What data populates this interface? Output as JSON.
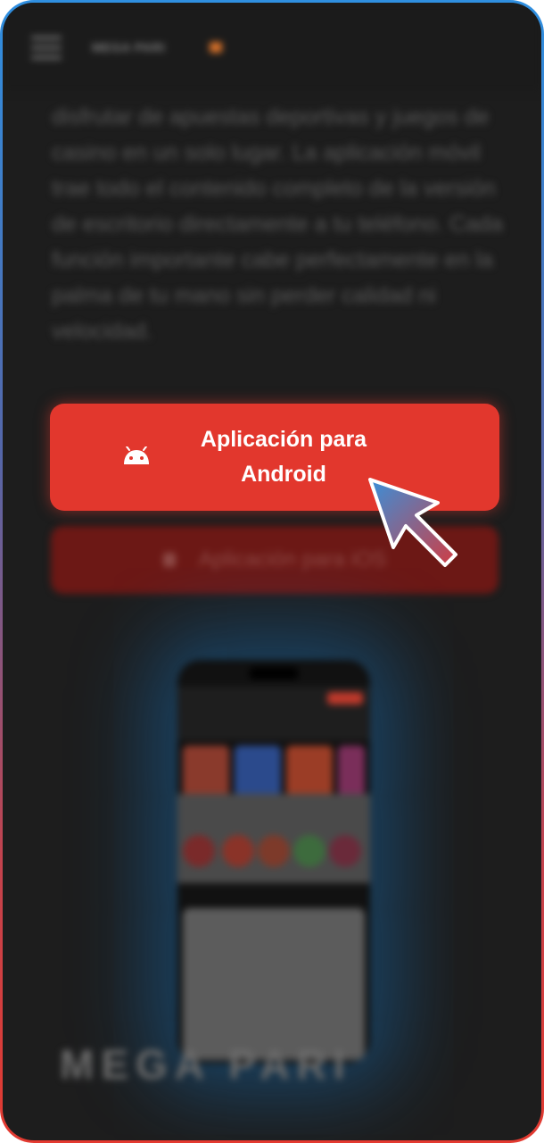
{
  "header": {
    "logo_text": "MEGA PARI",
    "menu_icon": "hamburger-menu-icon"
  },
  "content": {
    "paragraph": "disfrutar de apuestas deportivas y juegos de casino en un solo lugar. La aplicación móvil trae todo el contenido completo de la versión de escritorio directamente a tu teléfono. Cada función importante cabe perfectamente en la palma de tu mano sin perder calidad ni velocidad."
  },
  "buttons": {
    "android": {
      "label": "Aplicación para Android",
      "icon": "android-icon"
    },
    "ios": {
      "label": "Aplicación para iOS",
      "icon": "apple-icon"
    }
  },
  "promo": {
    "watermark": "MEGA PARI"
  },
  "colors": {
    "accent": "#e2372d",
    "background": "#1d1d1d",
    "frame_top": "#2f8fe0",
    "frame_bottom": "#e33a30"
  },
  "cursor": {
    "icon": "pointer-arrow-icon"
  }
}
